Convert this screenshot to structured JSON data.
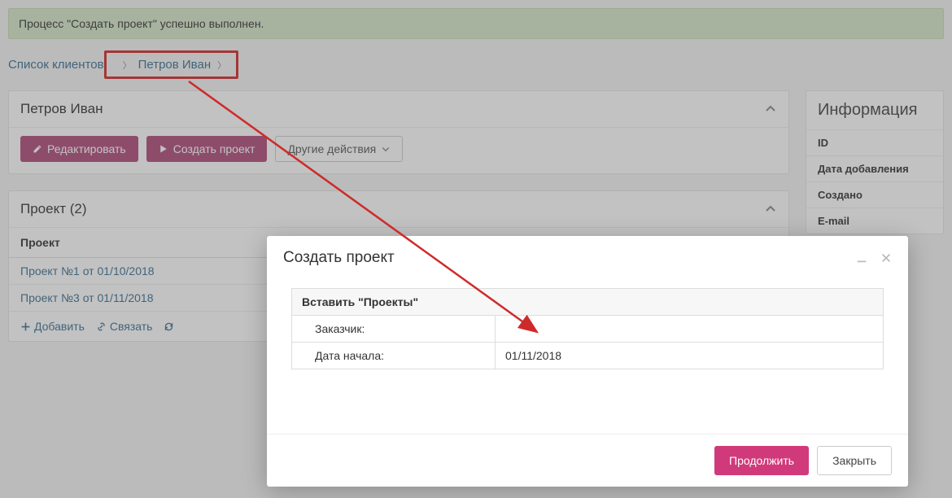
{
  "banner": {
    "text": "Процесс \"Создать проект\" успешно выполнен."
  },
  "breadcrumb": {
    "root": "Список клиентов",
    "current": "Петров Иван"
  },
  "client_panel": {
    "title": "Петров Иван",
    "edit_btn": "Редактировать",
    "create_btn": "Создать проект",
    "other_btn": "Другие действия"
  },
  "projects_panel": {
    "title": "Проект (2)",
    "col_header": "Проект",
    "items": [
      "Проект №1 от 01/10/2018",
      "Проект №3 от 01/11/2018"
    ],
    "add_label": "Добавить",
    "link_label": "Связать"
  },
  "info_panel": {
    "title": "Информация",
    "rows": [
      "ID",
      "Дата добавления",
      "Создано",
      "E-mail"
    ]
  },
  "modal": {
    "title": "Создать проект",
    "form_header": "Вставить \"Проекты\"",
    "row1_label": "Заказчик:",
    "row1_value": "",
    "row2_label": "Дата начала:",
    "row2_value": "01/11/2018",
    "continue_btn": "Продолжить",
    "close_btn": "Закрыть"
  }
}
